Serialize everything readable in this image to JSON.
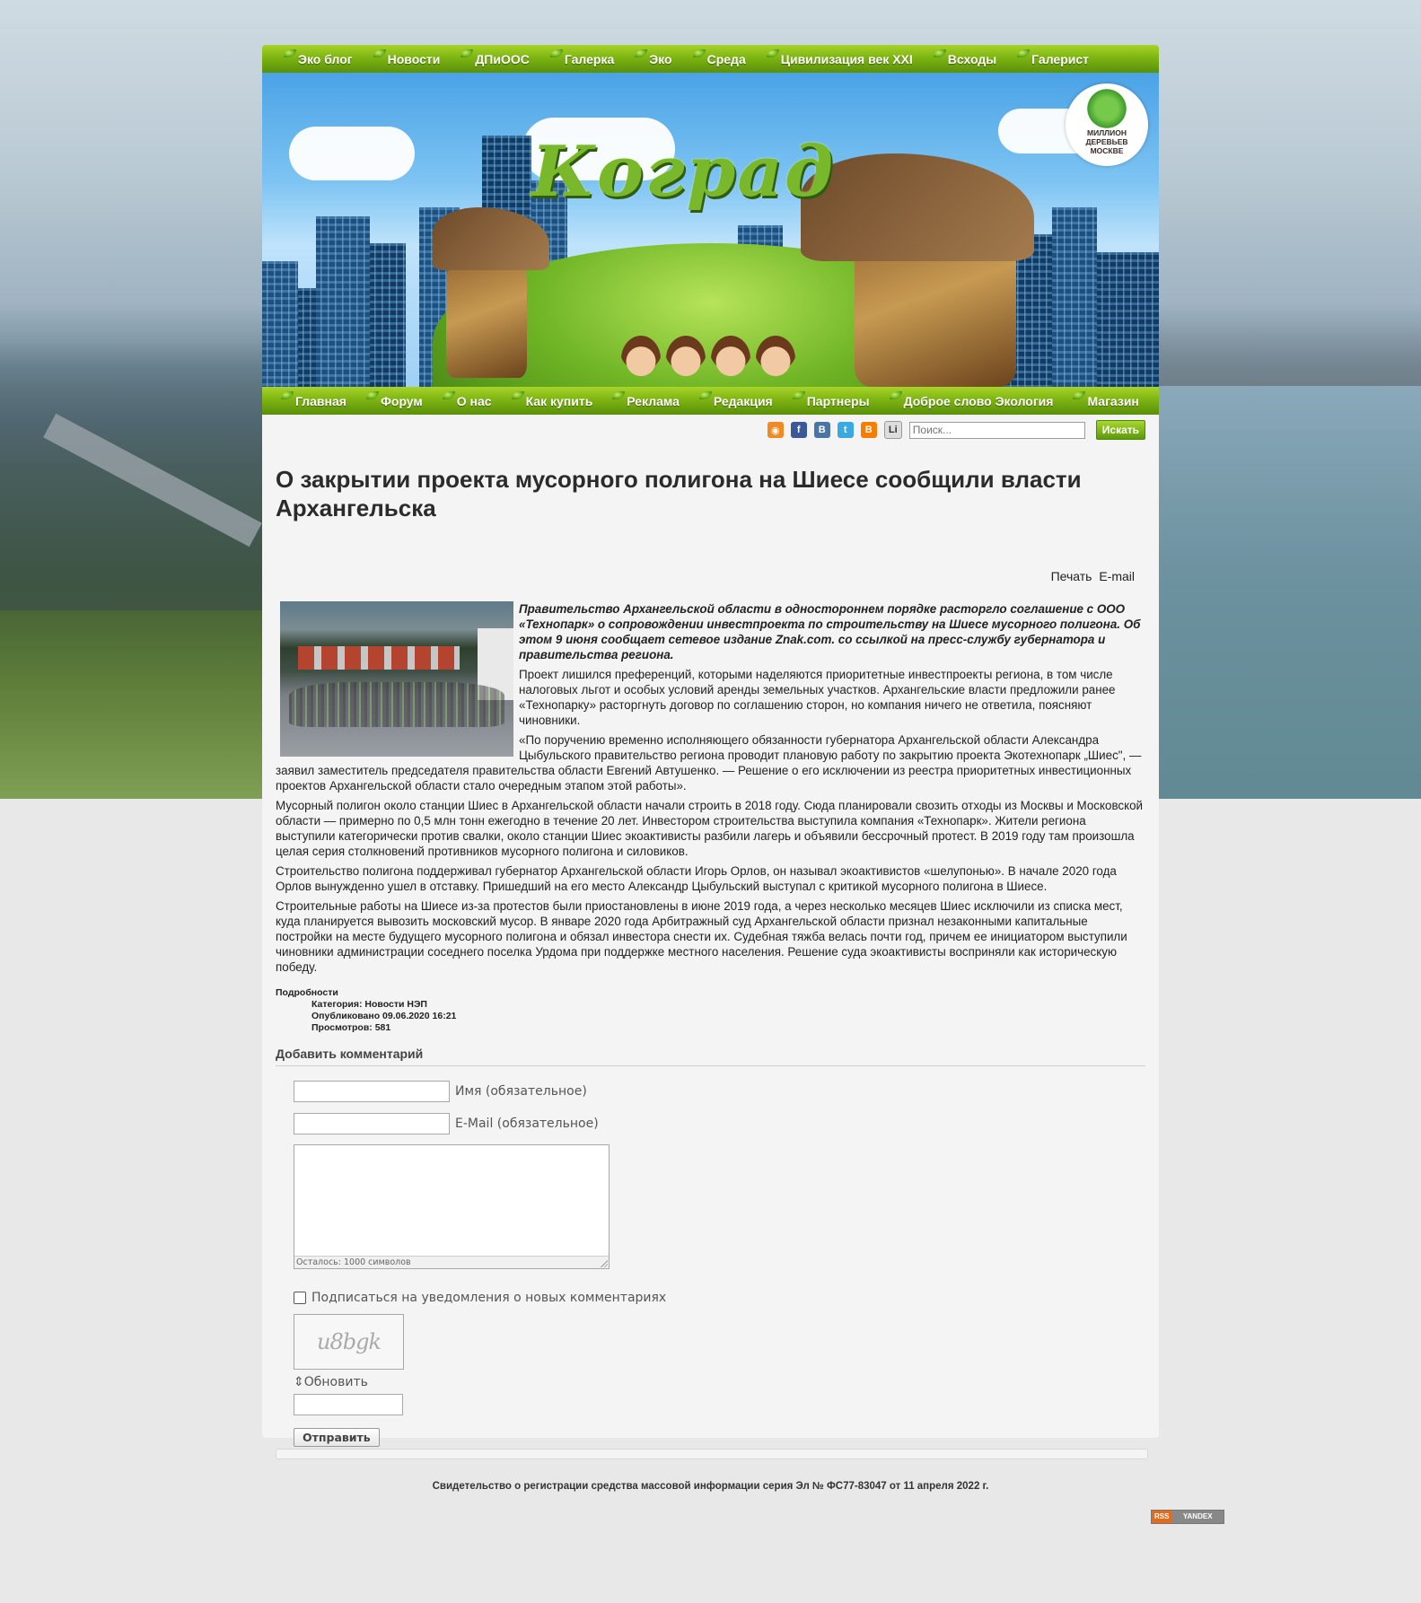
{
  "top_nav": [
    "Эко блог",
    "Новости",
    "ДПиООС",
    "Галерка",
    "Эко",
    "Среда",
    "Цивилизация век XXI",
    "Всходы",
    "Галерист"
  ],
  "banner": {
    "logo_text": "Коград",
    "badge_line1": "МИЛЛИОН",
    "badge_line2": "ДЕРЕВЬЕВ",
    "badge_line3": "МОСКВЕ"
  },
  "main_nav": [
    "Главная",
    "Форум",
    "О нас",
    "Как купить",
    "Реклама",
    "Редакция",
    "Партнеры",
    "Доброе слово Экология",
    "Магазин"
  ],
  "toolbar": {
    "social_icons": [
      "rss-icon",
      "facebook-icon",
      "vk-icon",
      "twitter-icon",
      "blogger-icon",
      "liveinternet-icon"
    ],
    "search_placeholder": "Поиск...",
    "search_button": "Искать"
  },
  "article": {
    "title": "О закрытии проекта мусорного полигона на Шиесе сообщили власти Архангельска",
    "print_label": "Печать",
    "email_label": "E-mail",
    "lead": "Правительство Архангельской области в одностороннем порядке расторгло соглашение с ООО «Технопарк» о сопровождении инвестпроекта по строительству на Шиесе мусорного полигона. Об этом 9 июня сообщает сетевое издание Znak.com. со ссылкой на пресс-службу губернатора и правительства региона.",
    "paragraphs": [
      "Проект лишился преференций, которыми наделяются приоритетные инвестпроекты региона, в том числе налоговых льгот и особых условий аренды земельных участков. Архангельские власти предложили ранее «Технопарку» расторгнуть договор по соглашению сторон, но компания ничего не ответила, поясняют чиновники.",
      "«По поручению временно исполняющего обязанности губернатора Архангельской области Александра Цыбульского правительство региона проводит плановую работу по закрытию проекта Экотехнопарк „Шиес\", — заявил заместитель председателя правительства области Евгений Автушенко. — Решение о его исключении из реестра приоритетных инвестиционных проектов Архангельской области стало очередным этапом этой работы».",
      "Мусорный полигон около станции Шиес в Архангельской области начали строить в 2018 году. Сюда планировали свозить отходы из Москвы и Московской области — примерно по 0,5 млн тонн ежегодно в течение 20 лет. Инвестором строительства выступила компания «Технопарк». Жители региона выступили категорически против свалки, около станции Шиес экоактивисты разбили лагерь и объявили бессрочный протест. В 2019 году там произошла целая серия столкновений противников мусорного полигона и силовиков.",
      "Строительство полигона поддерживал губернатор Архангельской области Игорь Орлов, он называл экоактивистов «шелупонью». В начале 2020 года Орлов вынужденно ушел в отставку. Пришедший на его место Александр Цыбульский выступал с критикой мусорного полигона в Шиесе.",
      "Строительные работы на Шиесе из-за протестов были приостановлены в июне 2019 года, а через несколько месяцев Шиес исключили из списка мест, куда планируется вывозить московский мусор. В январе 2020 года Арбитражный суд Архангельской области признал незаконными капитальные постройки на месте будущего мусорного полигона и обязал инвестора снести их. Судебная тяжба велась почти год, причем ее инициатором выступили чиновники администрации соседнего поселка Урдома при поддержке местного населения. Решение суда экоактивисты восприняли как историческую победу."
    ],
    "details_title": "Подробности",
    "category": "Категория: Новости НЭП",
    "published": "Опубликовано 09.06.2020 16:21",
    "views": "Просмотров: 581"
  },
  "comment_form": {
    "title": "Добавить комментарий",
    "name_label": "Имя (обязательное)",
    "email_label": "E-Mail (обязательное)",
    "counter": "Осталось: 1000 символов",
    "subscribe_label": "Подписаться на уведомления о новых комментариях",
    "captcha_text": "u8bgk",
    "refresh_label": "Обновить",
    "submit_label": "Отправить"
  },
  "footer": {
    "registration": "Свидетельство о регистрации средства массовой информации серия Эл № ФС77-83047 от 11 апреля 2022 г.",
    "rss_label": "RSS",
    "yandex_label": "YANDEX"
  },
  "colors": {
    "nav_green": "#7eb512",
    "content_bg": "#f4f4f4",
    "page_bg": "#e8e8e8"
  }
}
